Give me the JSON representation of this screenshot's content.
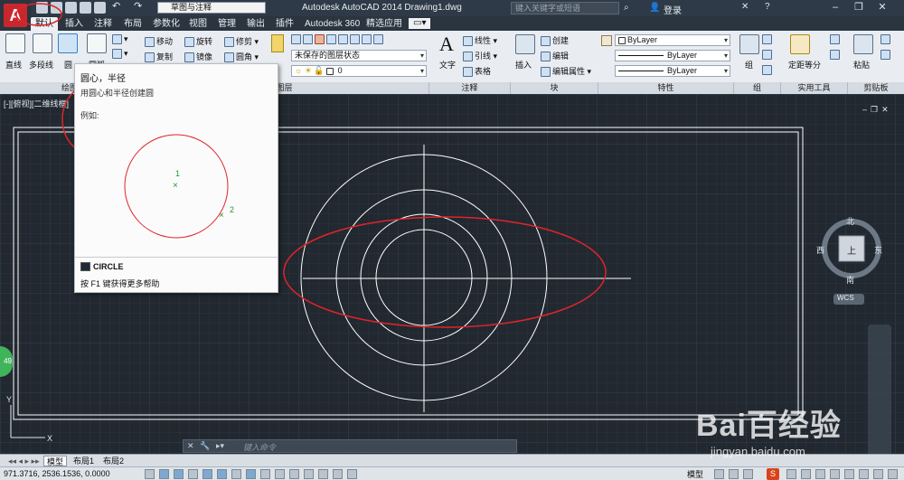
{
  "titlebar": {
    "workspace": "草图与注释",
    "app_title": "Autodesk AutoCAD 2014    Drawing1.dwg",
    "search_placeholder": "键入关键字或短语",
    "login": "登录"
  },
  "tabs": [
    "默认",
    "插入",
    "注释",
    "布局",
    "参数化",
    "视图",
    "管理",
    "输出",
    "插件",
    "Autodesk 360",
    "精选应用"
  ],
  "active_tab": "默认",
  "ribbon": {
    "draw": {
      "line": "直线",
      "polyline": "多段线",
      "circle": "圆",
      "arc": "圆弧",
      "panel_label": "绘图"
    },
    "modify": {
      "move": "移动",
      "rotate": "旋转",
      "trim": "修剪",
      "copy": "复制",
      "mirror": "镜像",
      "fillet": "圆角"
    },
    "layers": {
      "layer_state": "未保存的图层状态",
      "current_layer": "0",
      "panel_label": "图层"
    },
    "annotation": {
      "text": "文字",
      "linear": "线性",
      "leader": "引线",
      "table": "表格",
      "panel_label": "注释"
    },
    "block": {
      "insert": "插入",
      "create": "创建",
      "edit": "编辑",
      "edit_attr": "编辑属性",
      "panel_label": "块"
    },
    "properties": {
      "color": "ByLayer",
      "linetype": "ByLayer",
      "lineweight": "ByLayer",
      "panel_label": "特性"
    },
    "groups": {
      "group": "组",
      "panel_label": "组"
    },
    "utilities": {
      "measure": "定距等分",
      "panel_label": "实用工具"
    },
    "clipboard": {
      "paste": "粘贴",
      "panel_label": "剪贴板"
    }
  },
  "viewport": {
    "label": "[-][俯视][二维线框]"
  },
  "tooltip": {
    "title": "圆心，半径",
    "description": "用圆心和半径创建圆",
    "example": "例如:",
    "point1": "1",
    "point2": "2",
    "command": "CIRCLE",
    "help": "按 F1 键获得更多帮助"
  },
  "viewcube": {
    "north": "北",
    "south": "南",
    "east": "东",
    "west": "西",
    "top": "上",
    "wcs": "WCS"
  },
  "command_line": {
    "placeholder": "键入命令"
  },
  "layout_tabs": [
    "模型",
    "布局1",
    "布局2"
  ],
  "status": {
    "coords": "971.3716,    2536.1536,  0.0000",
    "model": "模型"
  },
  "badge": "49",
  "watermark": {
    "brand": "Bai百经验",
    "url": "jingyan.baidu.com"
  },
  "colors": {
    "canvas_bg": "#212830",
    "annotation": "#e0242a",
    "drawing_lines": "#ffffff"
  }
}
